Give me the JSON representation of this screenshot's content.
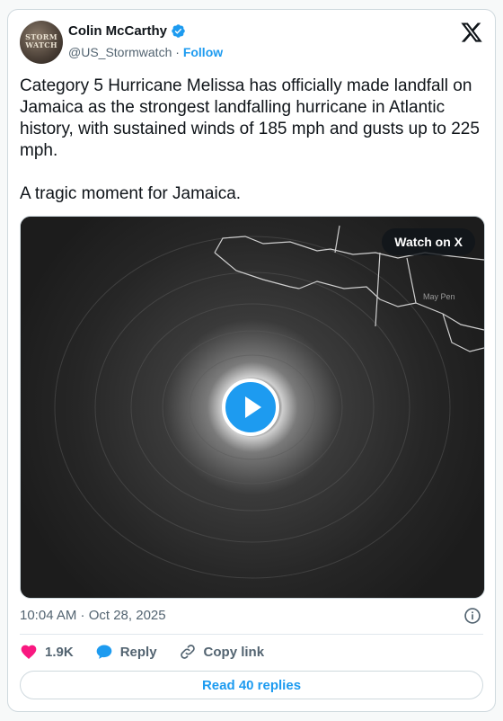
{
  "author": {
    "name": "Colin McCarthy",
    "handle": "@US_Stormwatch",
    "separator": " · ",
    "follow_label": "Follow",
    "avatar_text": "STORM\nWATCH"
  },
  "tweet": {
    "text": "Category 5 Hurricane Melissa has officially made landfall on Jamaica as the strongest landfalling hurricane in Atlantic history, with sustained winds of 185 mph and gusts up to 225 mph.\n\nA tragic moment for Jamaica."
  },
  "media": {
    "watch_label": "Watch on X",
    "map_label": "May Pen"
  },
  "meta": {
    "timestamp": "10:04 AM · Oct 28, 2025"
  },
  "actions": {
    "likes": "1.9K",
    "reply_label": "Reply",
    "copy_link_label": "Copy link"
  },
  "read_replies_label": "Read 40 replies",
  "colors": {
    "accent": "#1d9bf0",
    "like": "#f91880",
    "text_secondary": "#536471"
  }
}
